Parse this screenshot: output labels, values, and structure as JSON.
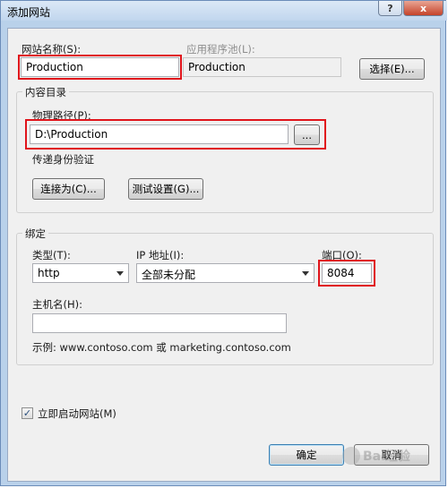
{
  "window": {
    "title": "添加网站"
  },
  "title_buttons": {
    "help": "?",
    "close": "x"
  },
  "site": {
    "name_label": "网站名称(S):",
    "name_value": "Production",
    "app_pool_label": "应用程序池(L):",
    "app_pool_value": "Production",
    "select_button": "选择(E)..."
  },
  "content": {
    "group_title": "内容目录",
    "path_label": "物理路径(P):",
    "path_value": "D:\\Production",
    "browse_button": "...",
    "passthrough_label": "传递身份验证",
    "connect_as_button": "连接为(C)...",
    "test_settings_button": "测试设置(G)..."
  },
  "binding": {
    "group_title": "绑定",
    "type_label": "类型(T):",
    "type_value": "http",
    "ip_label": "IP 地址(I):",
    "ip_value": "全部未分配",
    "port_label": "端口(O):",
    "port_value": "8084",
    "host_label": "主机名(H):",
    "host_value": "",
    "example_text": "示例: www.contoso.com 或 marketing.contoso.com"
  },
  "start_now": {
    "label": "立即启动网站(M)",
    "checked_mark": "✓"
  },
  "footer": {
    "ok_button": "确定",
    "cancel_button": "取消"
  },
  "watermark": {
    "text": "Bai经验"
  },
  "colors": {
    "highlight": "#e0141b",
    "window_frame": "#b9d1ea",
    "dialog_bg": "#f0f0f0"
  }
}
